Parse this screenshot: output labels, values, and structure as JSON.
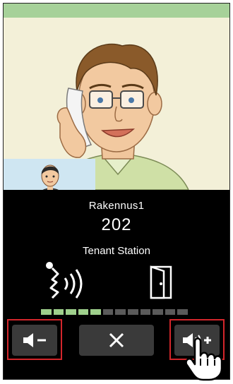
{
  "call": {
    "building": "Rakennus1",
    "room": "202",
    "station": "Tenant Station"
  },
  "volume": {
    "level": 5,
    "max": 12,
    "active_color": "#9fd08c",
    "inactive_color": "#5a5a5a"
  },
  "buttons": {
    "volume_down_icon": "speaker-minus",
    "end_call_icon": "close-x",
    "volume_up_icon": "speaker-plus"
  },
  "colors": {
    "status_strip": "#a6d199",
    "highlight": "#d3262b",
    "background": "#000000"
  }
}
